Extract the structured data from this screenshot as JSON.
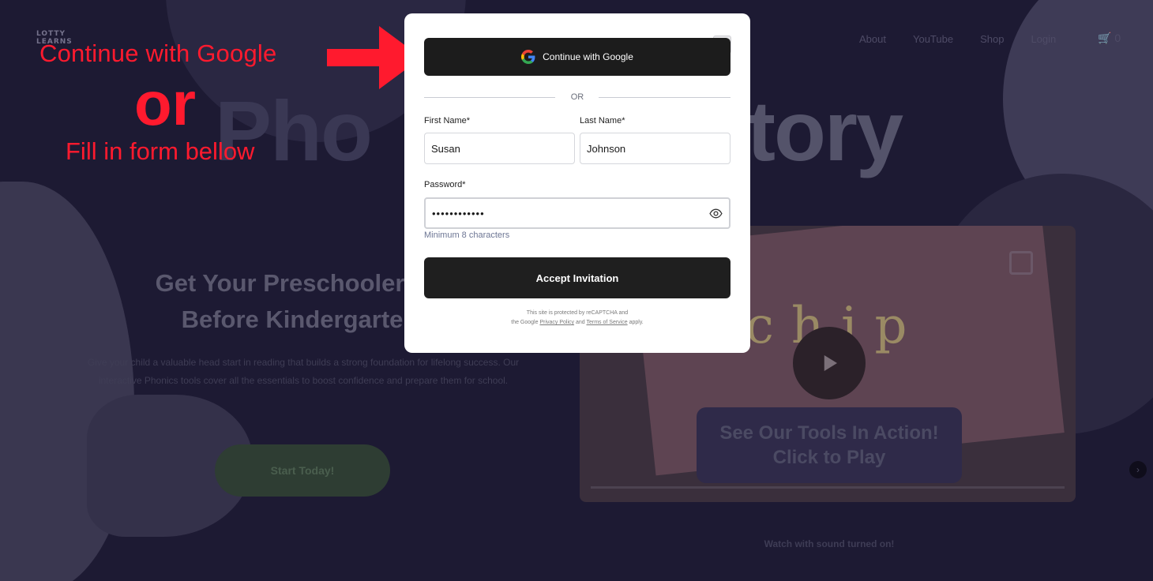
{
  "background": {
    "logo_lines": [
      "LOTTY",
      "LEARNS"
    ],
    "nav": [
      "About",
      "YouTube",
      "Shop",
      "Login"
    ],
    "cart_count": "0",
    "hero_word_left": "Pho",
    "hero_word_right": "tory",
    "hero_heading_line1": "Get Your Preschooler R",
    "hero_heading_line2": "Before Kindergarte",
    "hero_description": "Give your child a valuable head start in reading that builds a strong foundation for lifelong success. Our interactive Phonics tools cover all the essentials to boost confidence and prepare them for school.",
    "start_button": "Start Today!",
    "video_card_word": "chip",
    "video_callout_line1": "See Our Tools In Action!",
    "video_callout_line2": "Click to Play",
    "watch_note": "Watch with sound turned on!"
  },
  "annotations": {
    "google": "Continue with Google",
    "or": "or",
    "form": "Fill in form bellow",
    "arrow_color": "#ff1a2e"
  },
  "modal": {
    "google_button": "Continue with Google",
    "divider": "OR",
    "first_name_label": "First Name*",
    "first_name_value": "Susan",
    "last_name_label": "Last Name*",
    "last_name_value": "Johnson",
    "password_label": "Password*",
    "password_value": "••••••••••••",
    "password_hint": "Minimum 8 characters",
    "accept_button": "Accept Invitation",
    "recaptcha_line1": "This site is protected by reCAPTCHA and",
    "recaptcha_the": "the Google",
    "privacy_link": "Privacy Policy",
    "and": "and",
    "terms_link": "Terms of Service",
    "apply": "apply."
  },
  "colors": {
    "accent_red": "#ff1a2e",
    "modal_button": "#1c1c1c",
    "backdrop": "#1d1a33"
  }
}
